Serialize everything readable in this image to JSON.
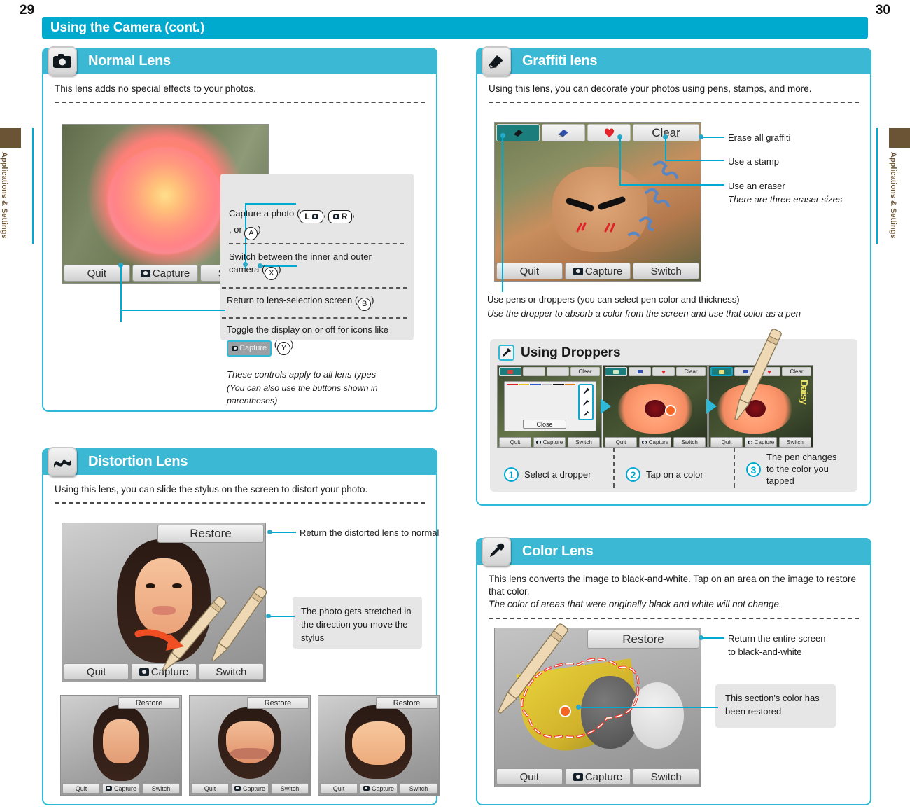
{
  "pages": {
    "left": "29",
    "right": "30"
  },
  "side_tab": {
    "label": "Applications & Settings",
    "color": "#6b5435"
  },
  "chapter": {
    "title": "Using the Camera (cont.)",
    "color": "#00a9ce"
  },
  "theme": {
    "accent": "#00a9cf",
    "header": "#3bb9d4",
    "card_border": "#2fb9d8",
    "gray_box": "#e6e6e6"
  },
  "normal_lens": {
    "title": "Normal Lens",
    "icon": "camera-icon",
    "lede": "This lens adds no special effects to your photos.",
    "screen_buttons": {
      "quit": "Quit",
      "capture": "Capture",
      "switch": "Switch"
    },
    "callouts": [
      {
        "text_before": "Capture a photo (",
        "btn1": "L",
        "btn2": "R",
        "text_mid": ", or ",
        "btn3": "A",
        "text_after": ")"
      },
      {
        "text_before": "Switch between the inner and outer camera (",
        "btn3": "X",
        "text_after": ")"
      },
      {
        "text_before": "Return to lens-selection screen (",
        "btn3": "B",
        "text_after": ")"
      },
      {
        "text_before": "Toggle the display on or off for icons like ",
        "chip": "Capture",
        "text_mid": " (",
        "btn3": "Y",
        "text_after": ")"
      }
    ],
    "note_line1": "These controls apply to all lens types",
    "note_line2": "(You can also use the buttons shown in parentheses)"
  },
  "distortion_lens": {
    "title": "Distortion Lens",
    "icon": "wave-icon",
    "lede": "Using this lens, you can slide the stylus on the screen to distort your photo.",
    "restore_label": "Restore",
    "screen_buttons": {
      "quit": "Quit",
      "capture": "Capture",
      "switch": "Switch"
    },
    "callout_restore": "Return the distorted lens to normal",
    "callout_stretch": "The photo gets stretched in the direction you move the stylus",
    "thumbnails": [
      {
        "restore": "Restore",
        "quit": "Quit",
        "capture": "Capture",
        "switch": "Switch"
      },
      {
        "restore": "Restore",
        "quit": "Quit",
        "capture": "Capture",
        "switch": "Switch"
      },
      {
        "restore": "Restore",
        "quit": "Quit",
        "capture": "Capture",
        "switch": "Switch"
      }
    ]
  },
  "graffiti_lens": {
    "title": "Graffiti lens",
    "icon": "pen-icon",
    "lede": "Using this lens, you can decorate your photos using pens, stamps, and more.",
    "toolbar": {
      "clear": "Clear"
    },
    "screen_buttons": {
      "quit": "Quit",
      "capture": "Capture",
      "switch": "Switch"
    },
    "callouts": [
      {
        "text": "Erase all graffiti",
        "italic": false
      },
      {
        "text": "Use a stamp",
        "italic": false
      },
      {
        "text": "Use an eraser",
        "italic": false
      },
      {
        "text": "There are three eraser sizes",
        "italic": true
      }
    ],
    "pen_note_line1": "Use pens or droppers (you can select pen color and thickness)",
    "pen_note_line2": "Use the dropper to absorb a color from the screen and use that color as a pen",
    "droppers_panel": {
      "title": "Using Droppers",
      "icon": "dropper-icon",
      "close_label": "Close",
      "clear_label": "Clear",
      "screen_buttons": {
        "quit": "Quit",
        "capture": "Capture",
        "switch": "Switch"
      },
      "steps": [
        {
          "no": "1",
          "text": "Select a dropper"
        },
        {
          "no": "2",
          "text": "Tap on a color"
        },
        {
          "no": "3",
          "text": "The pen changes to the color you tapped"
        }
      ],
      "palette_colors": [
        [
          "#e02020",
          "#f0c417",
          "#2a58c8",
          "#ffffff",
          "#111111",
          "#e07f18"
        ],
        [
          "#f05a28",
          "#8ec63f",
          "#6a3fa0",
          "#d8d8d8",
          "#3a3a3a",
          "#7a4a20"
        ],
        [
          "#e0457a",
          "#19a05a",
          "#1aa6c8",
          "#b9b9b9",
          "#5a5a5a",
          "#2b2b2b"
        ]
      ]
    }
  },
  "color_lens": {
    "title": "Color Lens",
    "icon": "dropper-icon",
    "lede_line1": "This lens converts the image to black-and-white. Tap on an area on the image to restore that color.",
    "lede_line2": "The color of areas that were originally black and white will not change.",
    "restore_label": "Restore",
    "screen_buttons": {
      "quit": "Quit",
      "capture": "Capture",
      "switch": "Switch"
    },
    "callout_restore_line1": "Return the entire screen",
    "callout_restore_line2": "to black-and-white",
    "callout_section_line1": "This section's color has",
    "callout_section_line2": "been restored"
  }
}
